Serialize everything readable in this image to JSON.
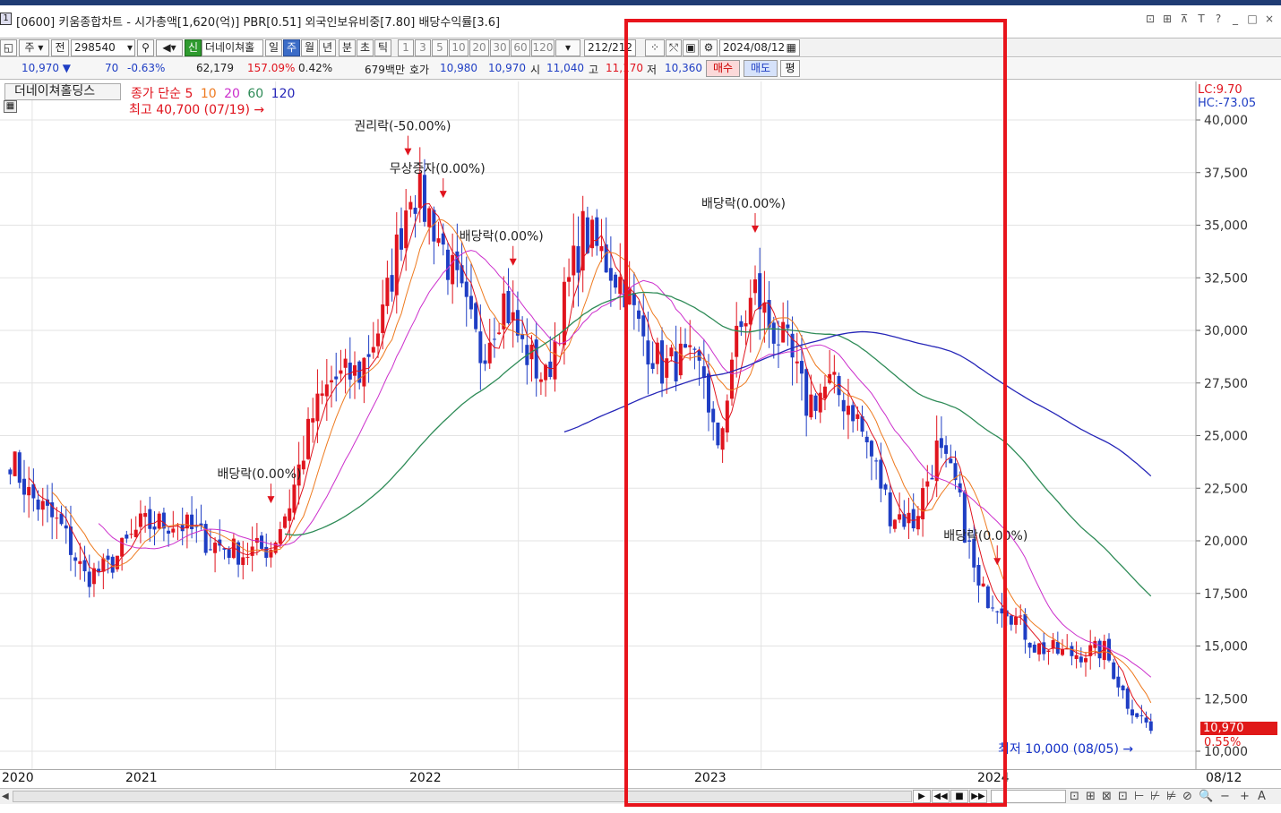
{
  "window": {
    "icon_label": "1",
    "title": "[0600] 키움종합차트 - 시가총액[1,620(억)] PBR[0.51] 외국인보유비중[7.80] 배당수익률[3.6]",
    "controls": [
      "⊡",
      "⊞",
      "⊼",
      "T",
      "?",
      "_",
      "□",
      "×"
    ]
  },
  "toolbar": {
    "period_type": "주",
    "mode": "전",
    "code": "298540",
    "stock_badge": "신",
    "stock_name": "더네이쳐홀",
    "period_buttons": [
      {
        "label": "일",
        "selected": false
      },
      {
        "label": "주",
        "selected": true
      },
      {
        "label": "월",
        "selected": false
      },
      {
        "label": "년",
        "selected": false
      },
      {
        "label": "분",
        "selected": false
      },
      {
        "label": "초",
        "selected": false
      },
      {
        "label": "틱",
        "selected": false
      }
    ],
    "interval_buttons": [
      "1",
      "3",
      "5",
      "10",
      "20",
      "30",
      "60",
      "120"
    ],
    "count": "212/212",
    "date": "2024/08/12"
  },
  "quote": {
    "price": "10,970 ▼",
    "change": "70",
    "change_pct": "-0.63%",
    "volume": "62,179",
    "volume_ratio": "157.09%",
    "turnover": "0.42%",
    "amount": "679백만",
    "bid_ask_label": "호가",
    "bid": "10,980",
    "ask": "10,970",
    "open_label": "시",
    "open": "11,040",
    "high_label": "고",
    "high": "11,170",
    "low_label": "저",
    "low": "10,360",
    "buy": "매수",
    "sell": "매도",
    "avg": "평"
  },
  "legend": {
    "stock_name": "더네이쳐홀딩스",
    "ma_title": "종가 단순",
    "ma_periods": [
      "5",
      "10",
      "20",
      "60",
      "120"
    ],
    "ma_colors": [
      "#e0141e",
      "#ee7a1f",
      "#cc2fcc",
      "#2e8b57",
      "#2626b8"
    ]
  },
  "annotations": {
    "max_label": "최고 40,700 (07/19) →",
    "min_label": "최저 10,000 (08/05) →",
    "lc": "LC:9.70",
    "hc": "HC:-73.05",
    "current_price": "10,970",
    "current_pct": "0.55%",
    "events": [
      "권리락(-50.00%)",
      "무상증자(0.00%)",
      "배당락(0.00%)",
      "배당락(0.00%)",
      "배당락(0.00%)",
      "배당락(0.00%)"
    ]
  },
  "x_axis": {
    "labels": [
      "2020",
      "2021",
      "2022",
      "2023",
      "2024"
    ],
    "end_label": "08/12"
  },
  "y_axis": {
    "ticks": [
      "40,000",
      "37,500",
      "35,000",
      "32,500",
      "30,000",
      "27,500",
      "25,000",
      "22,500",
      "20,000",
      "17,500",
      "15,000",
      "12,500",
      "10,000"
    ]
  },
  "colors": {
    "up": "#e0141e",
    "down": "#1f3ec4",
    "highlight": "#e8141c"
  },
  "scrollbar": {
    "nav_buttons": [
      "▶",
      "◀◀",
      "■",
      "▶▶"
    ],
    "tools": [
      "⊡",
      "⊞",
      "⊠",
      "⊡",
      "⊢",
      "⊬",
      "⊭",
      "⊘",
      "🔍",
      "−",
      "+",
      "A"
    ]
  },
  "chart_data": {
    "type": "candlestick",
    "title": "더네이쳐홀딩스",
    "period": "weekly",
    "ylim": [
      10000,
      41500
    ],
    "xlim": [
      "2019-11-15",
      "2024-08-12"
    ],
    "x_ticks": [
      "2020",
      "2021",
      "2022",
      "2023",
      "2024"
    ],
    "keypoints": [
      {
        "date": "2019-11-29",
        "close": 24000
      },
      {
        "date": "2019-12-27",
        "close": 22200
      },
      {
        "date": "2020-02-14",
        "close": 20600
      },
      {
        "date": "2020-03-20",
        "close": 18300
      },
      {
        "date": "2020-04-24",
        "close": 18700
      },
      {
        "date": "2020-06-12",
        "close": 20700
      },
      {
        "date": "2020-08-07",
        "close": 20900
      },
      {
        "date": "2020-09-25",
        "close": 19900
      },
      {
        "date": "2020-11-13",
        "close": 19400
      },
      {
        "date": "2020-12-25",
        "close": 19700
      },
      {
        "date": "2021-01-22",
        "close": 21800
      },
      {
        "date": "2021-02-26",
        "close": 25900
      },
      {
        "date": "2021-03-26",
        "close": 27600
      },
      {
        "date": "2021-05-07",
        "close": 28000
      },
      {
        "date": "2021-06-11",
        "close": 30600
      },
      {
        "date": "2021-07-02",
        "close": 33800
      },
      {
        "date": "2021-07-23",
        "close": 37000
      },
      {
        "date": "2021-08-27",
        "close": 35100
      },
      {
        "date": "2021-10-01",
        "close": 32000
      },
      {
        "date": "2021-11-05",
        "close": 28900
      },
      {
        "date": "2021-12-10",
        "close": 31500
      },
      {
        "date": "2022-01-07",
        "close": 29200
      },
      {
        "date": "2022-02-11",
        "close": 27600
      },
      {
        "date": "2022-03-11",
        "close": 31400
      },
      {
        "date": "2022-04-08",
        "close": 34700
      },
      {
        "date": "2022-05-13",
        "close": 33300
      },
      {
        "date": "2022-06-10",
        "close": 32100
      },
      {
        "date": "2022-07-01",
        "close": 30100
      },
      {
        "date": "2022-08-05",
        "close": 28200
      },
      {
        "date": "2022-09-02",
        "close": 28600
      },
      {
        "date": "2022-10-07",
        "close": 27900
      },
      {
        "date": "2022-10-28",
        "close": 23900
      },
      {
        "date": "2022-11-18",
        "close": 28800
      },
      {
        "date": "2022-12-23",
        "close": 31900
      },
      {
        "date": "2023-01-13",
        "close": 30300
      },
      {
        "date": "2023-02-10",
        "close": 29100
      },
      {
        "date": "2023-03-10",
        "close": 26500
      },
      {
        "date": "2023-04-14",
        "close": 27400
      },
      {
        "date": "2023-05-19",
        "close": 26300
      },
      {
        "date": "2023-06-16",
        "close": 24000
      },
      {
        "date": "2023-07-14",
        "close": 21400
      },
      {
        "date": "2023-08-18",
        "close": 20900
      },
      {
        "date": "2023-09-22",
        "close": 24300
      },
      {
        "date": "2023-10-20",
        "close": 22600
      },
      {
        "date": "2023-11-24",
        "close": 17600
      },
      {
        "date": "2024-01-05",
        "close": 16900
      },
      {
        "date": "2024-02-16",
        "close": 15000
      },
      {
        "date": "2024-04-05",
        "close": 14600
      },
      {
        "date": "2024-05-31",
        "close": 14800
      },
      {
        "date": "2024-07-05",
        "close": 12300
      },
      {
        "date": "2024-08-12",
        "close": 10970
      }
    ],
    "max": {
      "date": "2021-07-19",
      "value": 40700
    },
    "min": {
      "date": "2024-08-05",
      "value": 10000
    },
    "last": {
      "date": "2024-08-12",
      "value": 10970
    }
  }
}
